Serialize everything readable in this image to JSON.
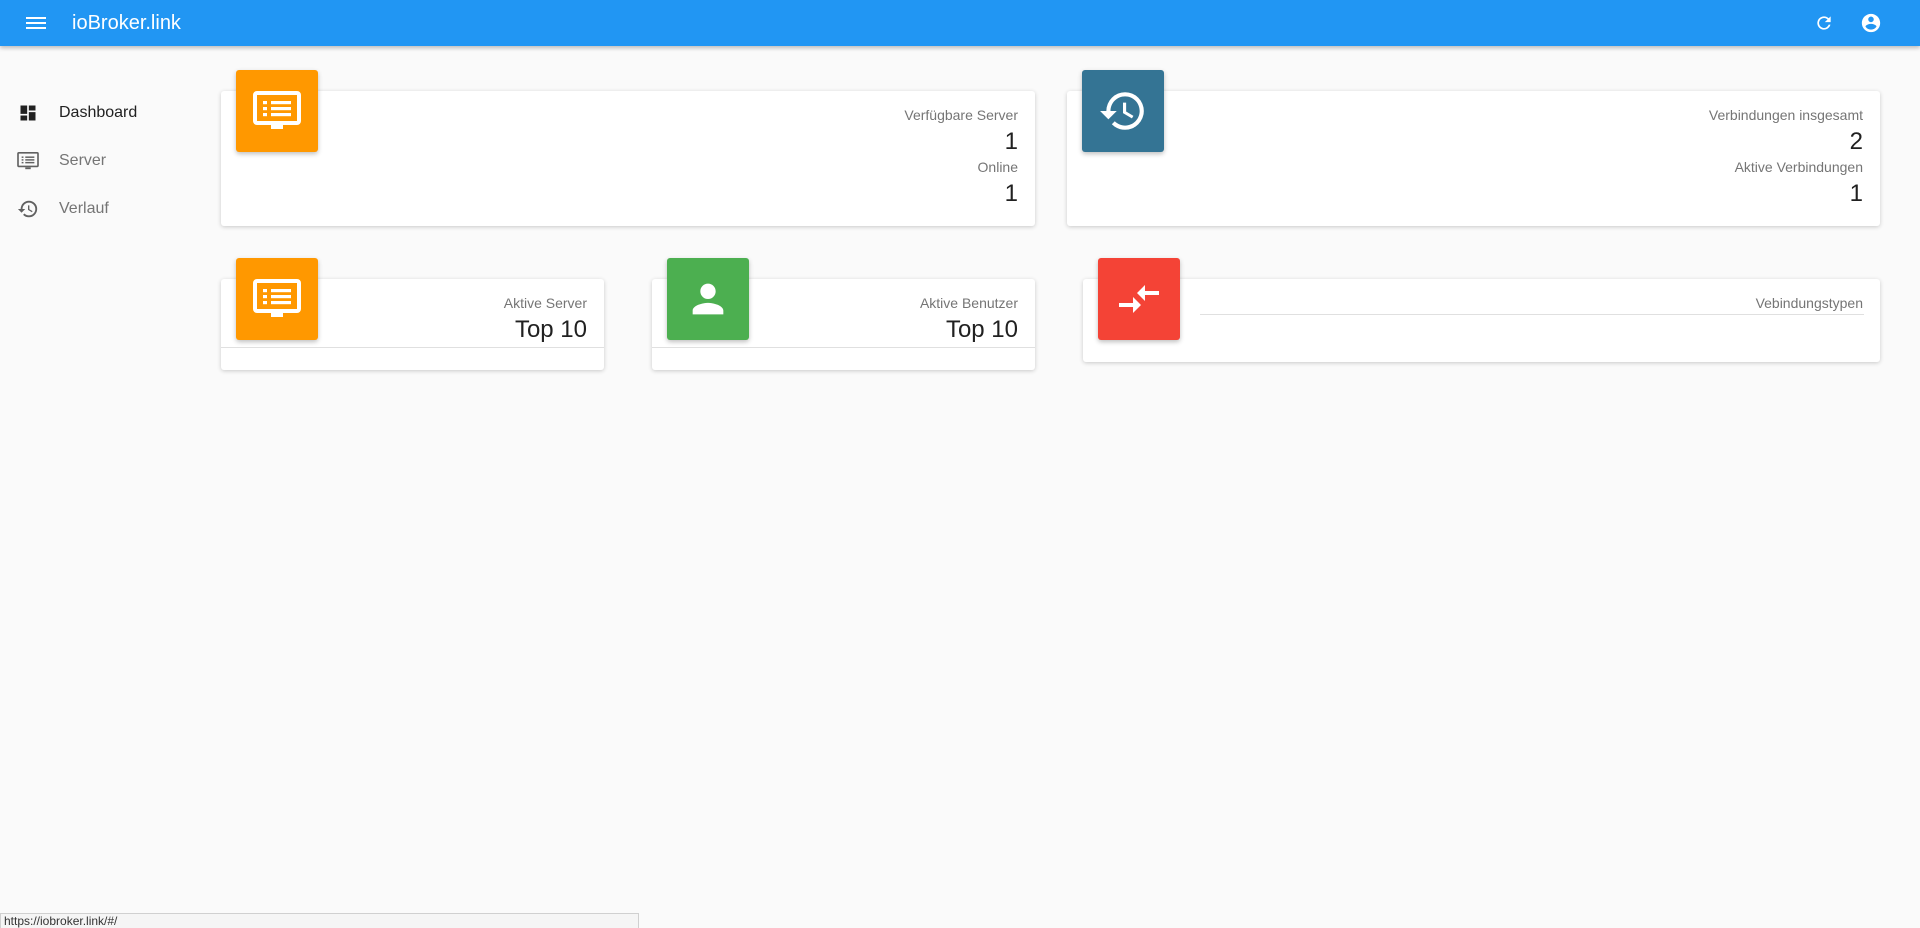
{
  "app": {
    "title": "ioBroker.link"
  },
  "colors": {
    "appbar": "#2196f3",
    "orange": "#ff9800",
    "teal": "#347494",
    "green": "#4caf50",
    "red": "#f44336"
  },
  "sidebar": {
    "items": [
      {
        "label": "Dashboard",
        "icon": "dashboard-icon",
        "active": true
      },
      {
        "label": "Server",
        "icon": "server-list-icon",
        "active": false
      },
      {
        "label": "Verlauf",
        "icon": "history-icon",
        "active": false
      }
    ]
  },
  "cards": {
    "servers": {
      "available_label": "Verfügbare Server",
      "available_value": "1",
      "online_label": "Online",
      "online_value": "1"
    },
    "connections": {
      "total_label": "Verbindungen insgesamt",
      "total_value": "2",
      "active_label": "Aktive Verbindungen",
      "active_value": "1"
    },
    "active_servers": {
      "label": "Aktive Server",
      "value": "Top 10"
    },
    "active_users": {
      "label": "Aktive Benutzer",
      "value": "Top 10"
    },
    "connection_types": {
      "label": "Vebindungstypen"
    }
  },
  "status_bar": {
    "url": "https://iobroker.link/#/"
  }
}
